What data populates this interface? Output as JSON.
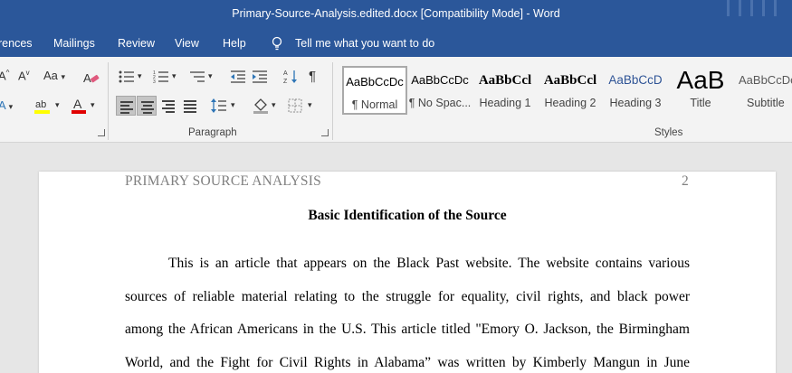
{
  "window": {
    "title": "Primary-Source-Analysis.edited.docx [Compatibility Mode]  -  Word"
  },
  "ribbon_tabs": {
    "references": "rences",
    "mailings": "Mailings",
    "review": "Review",
    "view": "View",
    "help": "Help",
    "tell_me": "Tell me what you want to do"
  },
  "ribbon": {
    "paragraph_group_label": "Paragraph",
    "styles_group_label": "Styles",
    "pilcrow": "¶",
    "styles": [
      {
        "preview": "AaBbCcDc",
        "name": "¶ Normal"
      },
      {
        "preview": "AaBbCcDc",
        "name": "¶ No Spac..."
      },
      {
        "preview": "AaBbCcl",
        "name": "Heading 1"
      },
      {
        "preview": "AaBbCcl",
        "name": "Heading 2"
      },
      {
        "preview": "AaBbCcD",
        "name": "Heading 3"
      },
      {
        "preview": "AaB",
        "name": "Title"
      },
      {
        "preview": "AaBbCcDc",
        "name": "Subtitle"
      }
    ]
  },
  "document": {
    "running_header": "PRIMARY SOURCE ANALYSIS",
    "page_number": "2",
    "heading": "Basic Identification of the Source",
    "lines": [
      "This is an article that appears on the Black Past website. The website contains various",
      "sources of reliable material relating to the struggle for equality, civil rights, and black power",
      "among the African Americans in the U.S. This article titled \"Emory O. Jackson, the Birmingham",
      "World, and the Fight for Civil Rights in Alabama” was written by Kimberly Mangun in June"
    ]
  },
  "colors": {
    "title_bar": "#2b579a",
    "ribbon_bg": "#f3f3f3",
    "canvas_bg": "#e6e6e6",
    "heading_style_blue": "#2f5496"
  }
}
